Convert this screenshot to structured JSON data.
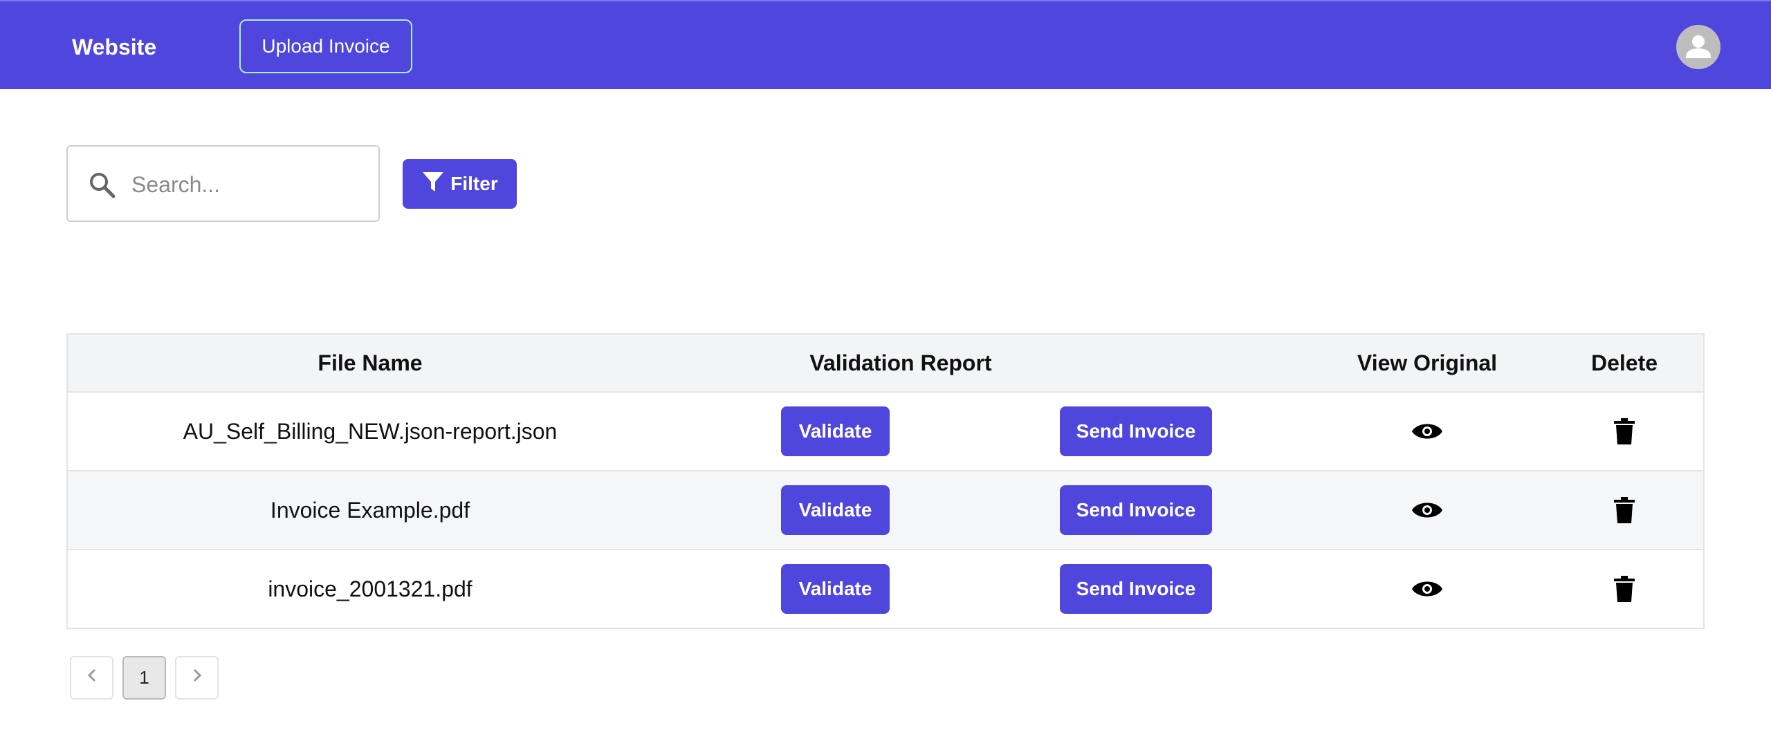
{
  "header": {
    "brand": "Website",
    "upload_label": "Upload Invoice",
    "avatar_icon": "account-circle-icon"
  },
  "toolbar": {
    "search_placeholder": "Search...",
    "search_value": "",
    "search_icon": "search-icon",
    "filter_label": "Filter",
    "filter_icon": "filter-icon"
  },
  "table": {
    "headers": {
      "file_name": "File Name",
      "validation_report": "Validation Report",
      "actions": "",
      "view_original": "View Original",
      "delete": "Delete"
    },
    "rows": [
      {
        "file_name": "AU_Self_Billing_NEW.json-report.json",
        "validate_label": "Validate",
        "send_label": "Send Invoice"
      },
      {
        "file_name": "Invoice Example.pdf",
        "validate_label": "Validate",
        "send_label": "Send Invoice"
      },
      {
        "file_name": "invoice_2001321.pdf",
        "validate_label": "Validate",
        "send_label": "Send Invoice"
      }
    ],
    "view_icon": "eye-icon",
    "delete_icon": "trash-icon"
  },
  "pagination": {
    "prev_icon": "chevron-left-icon",
    "current_page": "1",
    "next_icon": "chevron-right-icon"
  },
  "colors": {
    "primary": "#4f46de",
    "header_bg": "#4f46de",
    "upload_border": "#a9f1f0",
    "table_header_bg": "#f3f4f6",
    "row_alt_bg": "#f5f6f8"
  }
}
